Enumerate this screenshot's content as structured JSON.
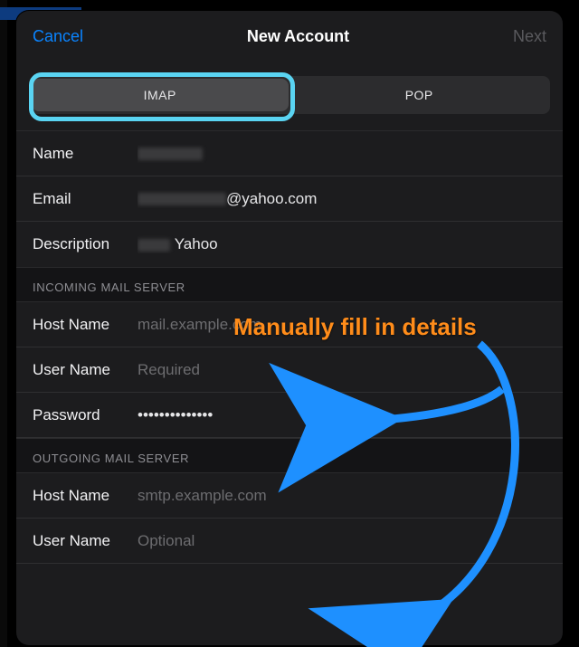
{
  "header": {
    "cancel": "Cancel",
    "title": "New Account",
    "next": "Next"
  },
  "segmented": {
    "imap": "IMAP",
    "pop": "POP",
    "selected": "IMAP"
  },
  "account": {
    "name_label": "Name",
    "email_label": "Email",
    "email_suffix": "@yahoo.com",
    "description_label": "Description",
    "description_value_visible": "Yahoo"
  },
  "incoming": {
    "header": "INCOMING MAIL SERVER",
    "host_label": "Host Name",
    "host_placeholder": "mail.example.com",
    "user_label": "User Name",
    "user_placeholder": "Required",
    "password_label": "Password",
    "password_value": "••••••••••••••"
  },
  "outgoing": {
    "header": "OUTGOING MAIL SERVER",
    "host_label": "Host Name",
    "host_placeholder": "smtp.example.com",
    "user_label": "User Name",
    "user_placeholder": "Optional"
  },
  "annotation": {
    "text": "Manually fill in details",
    "color": "#ff8c1a",
    "arrow_color": "#1e90ff"
  }
}
